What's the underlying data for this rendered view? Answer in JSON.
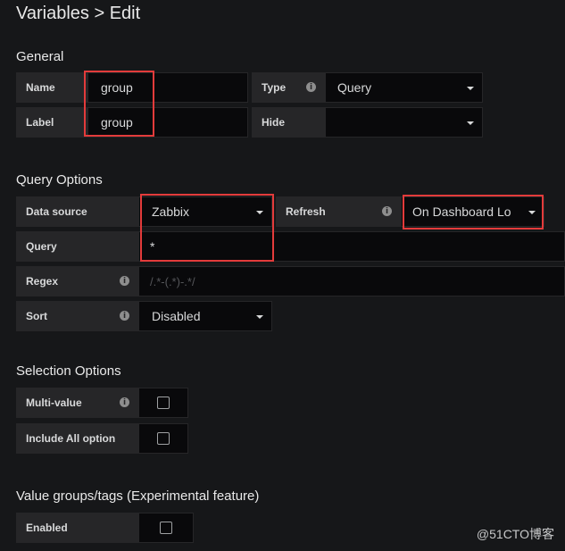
{
  "page": {
    "title": "Variables > Edit"
  },
  "general": {
    "title": "General",
    "name_label": "Name",
    "name_value": "group",
    "type_label": "Type",
    "type_value": "Query",
    "label_label": "Label",
    "label_value": "group",
    "hide_label": "Hide",
    "hide_value": ""
  },
  "query_options": {
    "title": "Query Options",
    "datasource_label": "Data source",
    "datasource_value": "Zabbix",
    "refresh_label": "Refresh",
    "refresh_value": "On Dashboard Lo",
    "query_label": "Query",
    "query_value": "*",
    "regex_label": "Regex",
    "regex_placeholder": "/.*-(.*)-.*/",
    "sort_label": "Sort",
    "sort_value": "Disabled"
  },
  "selection_options": {
    "title": "Selection Options",
    "multi_value_label": "Multi-value",
    "include_all_label": "Include All option"
  },
  "value_groups": {
    "title": "Value groups/tags (Experimental feature)",
    "enabled_label": "Enabled"
  },
  "watermark": "@51CTO博客",
  "icons": {
    "info": "info-icon",
    "caret": "caret-down-icon",
    "checkbox": "checkbox-icon"
  },
  "colors": {
    "background": "#161719",
    "label_bg": "#262628",
    "input_bg": "#09090b",
    "highlight": "#e33b3b"
  }
}
